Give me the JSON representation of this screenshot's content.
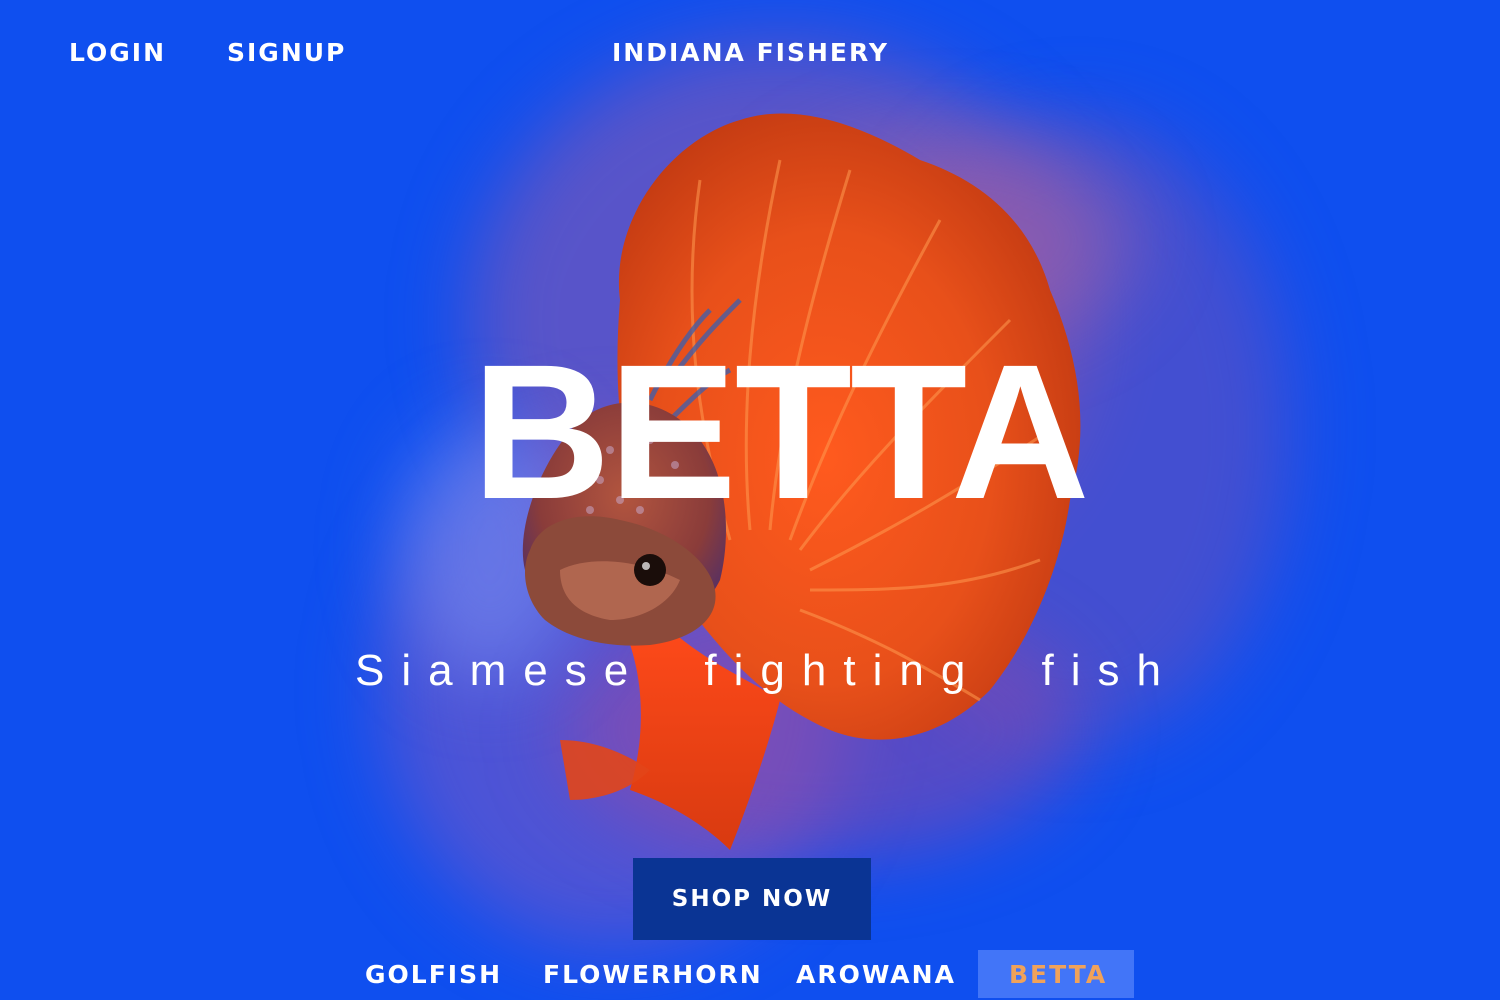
{
  "nav": {
    "login_label": "LOGIN",
    "signup_label": "SIGNUP",
    "brand": "INDIANA FISHERY"
  },
  "hero": {
    "title": "BETTA",
    "subtitle": "Siamese fighting fish",
    "cta_label": "SHOP NOW"
  },
  "fish_tabs": {
    "items": [
      {
        "label": "GOLFISH",
        "active": false
      },
      {
        "label": "FLOWERHORN",
        "active": false
      },
      {
        "label": "AROWANA",
        "active": false
      },
      {
        "label": "BETTA",
        "active": true
      }
    ]
  },
  "colors": {
    "background": "#0f4fef",
    "button": "#0a3494",
    "active_tab_text": "#f0a25a",
    "active_tab_bg": "#6e96ff"
  }
}
